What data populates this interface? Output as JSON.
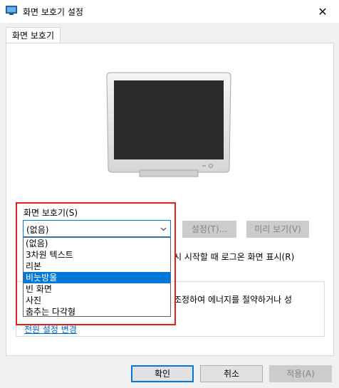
{
  "window": {
    "title": "화면 보호기 설정",
    "close_glyph": "✕"
  },
  "tab": {
    "label": "화면 보호기"
  },
  "screensaver": {
    "group_label": "화면 보호기(S)",
    "selected": "(없음)",
    "options": [
      "(없음)",
      "3차원 텍스트",
      "리본",
      "비눗방울",
      "빈 화면",
      "사진",
      "춤추는 다각형"
    ],
    "highlighted_option": "비눗방울",
    "settings_label": "설정(T)...",
    "preview_label": "미리 보기(V)",
    "logon_partial_text": "시 시작할 때 로그온 화면 표시(R)"
  },
  "power": {
    "partial_text": "조정하여 에너지를 절약하거나 성",
    "link_label": "전원 설정 변경"
  },
  "footer": {
    "ok_label": "확인",
    "cancel_label": "취소",
    "apply_label": "적용(A)"
  },
  "colors": {
    "accent": "#0078d7",
    "highlight_box": "#e41e1e"
  }
}
